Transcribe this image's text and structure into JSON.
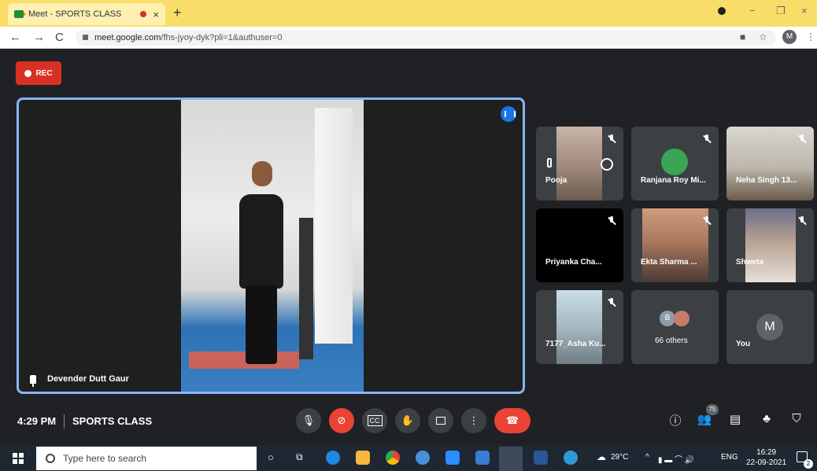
{
  "browser": {
    "tab_title": "Meet - SPORTS CLASS",
    "tab_close": "×",
    "new_tab": "+",
    "url_host": "meet.google.com",
    "url_path": "/fhs-jyoy-dyk?pli=1&authuser=0",
    "profile_initial": "M",
    "win_minimize": "−",
    "win_restore": "❐",
    "win_close": "×"
  },
  "meet": {
    "rec_label": "REC",
    "main_speaker": "Devender Dutt Gaur",
    "participants": [
      {
        "name": "Pooja"
      },
      {
        "name": "Ranjana Roy Mi..."
      },
      {
        "name": "Neha Singh 13..."
      },
      {
        "name": "Priyanka Cha..."
      },
      {
        "name": "Ekta Sharma ..."
      },
      {
        "name": "Shweta"
      },
      {
        "name": "7177_Asha Ku..."
      },
      {
        "name": "66 others",
        "avatar": "B"
      },
      {
        "name": "You",
        "avatar": "M"
      }
    ],
    "time": "4:29 PM",
    "meeting_title": "SPORTS CLASS",
    "people_count": "75"
  },
  "taskbar": {
    "search_placeholder": "Type here to search",
    "weather": "29°C",
    "lang": "ENG",
    "clock_time": "16:29",
    "clock_date": "22-09-2021",
    "notif_count": "2"
  },
  "colors": {
    "accent": "#8ab4f8",
    "rec": "#d93025",
    "end_call": "#ea4335",
    "tile_bg": "#3c4043"
  }
}
